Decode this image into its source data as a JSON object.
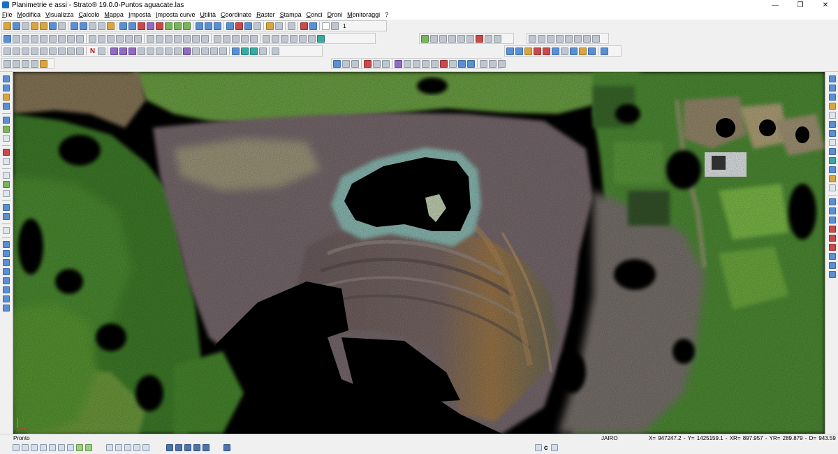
{
  "window": {
    "title": "Planimetrie e assi - Strato® 19.0.0-Puntos aguacate.las",
    "controls": {
      "minimize": "—",
      "maximize": "❐",
      "close": "✕"
    }
  },
  "menu": [
    "File",
    "Modifica",
    "Visualizza",
    "Calcolo",
    "Mappa",
    "Imposta",
    "Imposta curve",
    "Utilità",
    "Coordinate",
    "Raster",
    "Stampa",
    "Conci",
    "Droni",
    "Monitoraggi",
    "?"
  ],
  "toolbar": {
    "layer_number": "1",
    "text_tool_glyph": "N",
    "bottom_tool_glyph": "c"
  },
  "status": {
    "ready": "Pronto",
    "user": "JAIRO",
    "coords": "X= 947247.2 - Y= 1425159.1 - XR= 897.957 - YR= 289.879 - D= 943.59"
  },
  "colors": {
    "window_bg": "#f0f0f0",
    "canvas_bg": "#000000",
    "grass": "#5e9a3a",
    "soil": "#8a7a78",
    "water_rim": "#8fc0b8"
  }
}
